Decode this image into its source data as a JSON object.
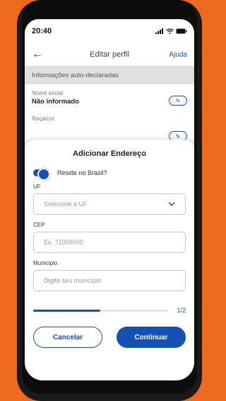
{
  "status_bar": {
    "time": "20:40",
    "icons": [
      "signal-icon",
      "wifi-icon",
      "battery-icon"
    ]
  },
  "appbar": {
    "title": "Editar perfil",
    "help": "Ajuda"
  },
  "section": {
    "header": "Informações auto-declaradas"
  },
  "fields": [
    {
      "label": "Nome social",
      "value": "Não informado"
    },
    {
      "label": "Raça/cor",
      "value": ""
    }
  ],
  "sheet": {
    "title": "Adicionar Endereço",
    "toggle_label": "Reside no Brasil?",
    "toggle_on": true,
    "uf": {
      "label": "UF",
      "placeholder": "Selecione a UF"
    },
    "cep": {
      "label": "CEP",
      "placeholder": "Ex. 71000000"
    },
    "municipio": {
      "label": "Município",
      "placeholder": "Digite seu município"
    },
    "progress": {
      "text": "1/2",
      "fraction": 0.5
    },
    "cancel_label": "Cancelar",
    "continue_label": "Continuar"
  },
  "colors": {
    "accent": "#1351B4",
    "background": "#EE6A1F"
  }
}
